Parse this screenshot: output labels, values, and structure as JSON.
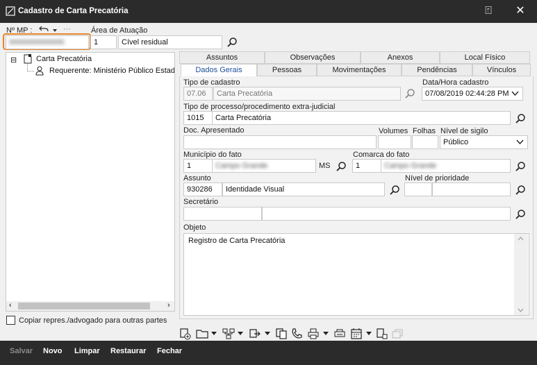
{
  "window": {
    "title": "Cadastro de Carta Precatória",
    "minimize": "⍐",
    "close": "✕"
  },
  "header": {
    "mp_label": "Nº MP :",
    "mp_value": "0000000000000",
    "area_label": "Área de Atuação",
    "area_code": "1",
    "area_name": "Cível residual"
  },
  "tree": {
    "root": "Carta Precatória",
    "child": "Requerente: Ministério Público Estad",
    "expander": "⊟"
  },
  "copy_checkbox": {
    "label": "Copiar repres./advogado para outras partes",
    "checked": false
  },
  "tabs_row1": [
    "Assuntos",
    "Observações",
    "Anexos",
    "Local Físico"
  ],
  "tabs_row2": [
    "Dados Gerais",
    "Pessoas",
    "Movimentações",
    "Pendências",
    "Vínculos"
  ],
  "active_tab": "Dados Gerais",
  "form": {
    "tipo_cadastro_label": "Tipo de cadastro",
    "tipo_cadastro_code": "07.06",
    "tipo_cadastro_name": "Carta Precatória",
    "data_hora_label": "Data/Hora cadastro",
    "data_hora_value": "07/08/2019 02:44:28 PM",
    "tipo_processo_label": "Tipo de processo/procedimento extra-judicial",
    "tipo_processo_code": "1015",
    "tipo_processo_name": "Carta Precatória",
    "doc_label": "Doc. Apresentado",
    "doc_value": "",
    "volumes_label": "Volumes",
    "volumes_value": "",
    "folhas_label": "Folhas",
    "folhas_value": "",
    "sigilo_label": "Nível de sigilo",
    "sigilo_value": "Público",
    "municipio_label": "Município do fato",
    "municipio_code": "1",
    "municipio_name": "Campo Grande",
    "municipio_uf": "MS",
    "comarca_label": "Comarca do fato",
    "comarca_code": "1",
    "comarca_name": "Campo Grande",
    "assunto_label": "Assunto",
    "assunto_code": "930286",
    "assunto_name": "Identidade Visual",
    "prioridade_label": "Nível de prioridade",
    "prioridade_code": "",
    "prioridade_name": "",
    "secretario_label": "Secretário",
    "secretario_code": "",
    "secretario_name": "",
    "objeto_label": "Objeto",
    "objeto_value": "Registro de Carta Precatória"
  },
  "bottom_buttons": {
    "salvar": "Salvar",
    "novo": "Novo",
    "limpar": "Limpar",
    "restaurar": "Restaurar",
    "fechar": "Fechar"
  },
  "colors": {
    "titlebar": "#2b2b2b",
    "highlight": "#e8852a",
    "active_tab_text": "#1b4f9c"
  }
}
